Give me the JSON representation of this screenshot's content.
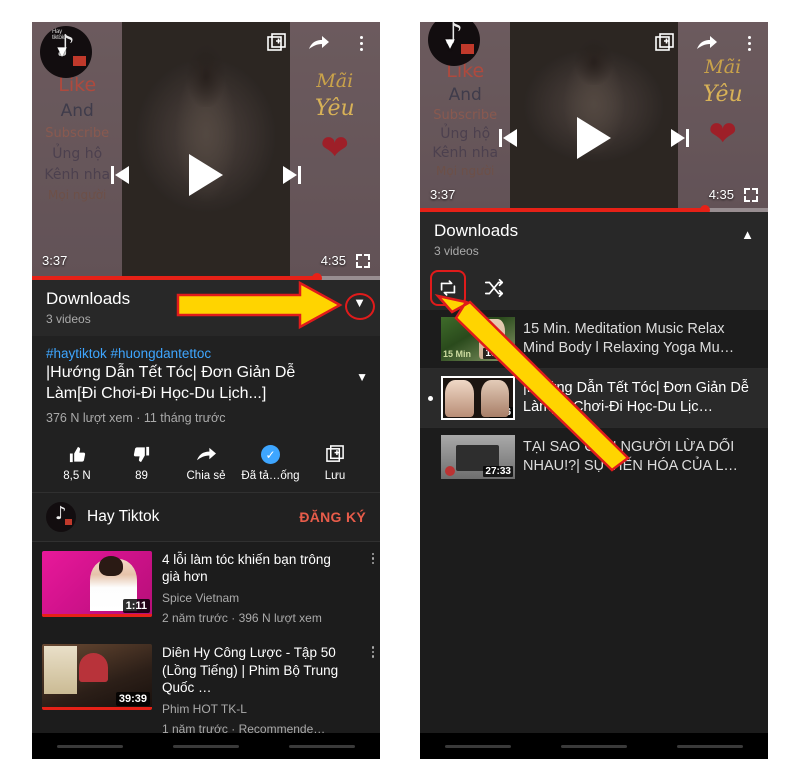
{
  "left_panel": {
    "player": {
      "avatar_icon": "tiktok-channel-avatar",
      "collapse_icon": "chevron-down-icon",
      "top_icons": [
        "add-to-queue-icon",
        "share-icon",
        "more-vertical-icon"
      ],
      "overlay_left_text": [
        "Like",
        "And",
        "Subscribe",
        "Ủng hộ",
        "Kênh nha",
        "Mọi người"
      ],
      "overlay_right_text": [
        "Mãi",
        "Yêu"
      ],
      "heart_icon": "heart-icon",
      "prev_icon": "skip-previous-icon",
      "play_icon": "play-icon",
      "next_icon": "skip-next-icon",
      "current_time": "3:37",
      "duration": "4:35",
      "fullscreen_icon": "fullscreen-icon",
      "progress_percent": 82
    },
    "downloads": {
      "title": "Downloads",
      "subtitle": "3 videos",
      "toggle_icon": "chevron-down-icon"
    },
    "description": {
      "tags": "#haytiktok #huongdantettoc",
      "title": "|Hướng Dẫn Tết Tóc| Đơn Giản Dễ Làm[Đi Chơi-Đi Học-Du Lịch...]",
      "meta": "376 N lượt xem · 11 tháng trước",
      "expand_icon": "chevron-down-icon"
    },
    "actions": [
      {
        "label": "8,5 N",
        "icon": "thumbs-up-icon"
      },
      {
        "label": "89",
        "icon": "thumbs-down-icon"
      },
      {
        "label": "Chia sẻ",
        "icon": "share-icon"
      },
      {
        "label": "Đã tả…ống",
        "icon": "downloaded-check-icon"
      },
      {
        "label": "Lưu",
        "icon": "save-icon"
      }
    ],
    "channel": {
      "name": "Hay Tiktok",
      "subscribe_label": "ĐĂNG KÝ",
      "avatar_icon": "tiktok-avatar-icon"
    },
    "related": [
      {
        "title": "4 lỗi làm tóc khiến bạn trông già hơn",
        "channel": "Spice Vietnam",
        "meta": "2 năm trước · 396 N lượt xem",
        "duration": "1:11",
        "menu_icon": "more-vertical-icon"
      },
      {
        "title": "Diên Hy Công Lược - Tập 50 (Lồng Tiếng) | Phim Bộ Trung Quốc …",
        "channel": "Phim HOT TK-L",
        "meta": "1 năm trước · Recommende…",
        "duration": "39:39",
        "menu_icon": "more-vertical-icon"
      }
    ]
  },
  "right_panel": {
    "player": {
      "avatar_icon": "tiktok-channel-avatar",
      "collapse_icon": "chevron-down-icon",
      "top_icons": [
        "add-to-queue-icon",
        "share-icon",
        "more-vertical-icon"
      ],
      "overlay_left_text": [
        "Like",
        "And",
        "Subscribe",
        "Ủng hộ",
        "Kênh nha",
        "Mọi người"
      ],
      "overlay_right_text": [
        "Mãi",
        "Yêu"
      ],
      "heart_icon": "heart-icon",
      "prev_icon": "skip-previous-icon",
      "play_icon": "play-icon",
      "next_icon": "skip-next-icon",
      "current_time": "3:37",
      "duration": "4:35",
      "fullscreen_icon": "fullscreen-icon",
      "progress_percent": 82
    },
    "downloads": {
      "title": "Downloads",
      "subtitle": "3 videos",
      "toggle_icon": "chevron-up-icon"
    },
    "playlist_controls": [
      {
        "icon": "repeat-icon",
        "highlighted": true
      },
      {
        "icon": "shuffle-icon",
        "highlighted": false
      }
    ],
    "playlist": [
      {
        "title": "15 Min. Meditation Music Relax Mind Body l Relaxing Yoga Mu…",
        "duration": "15:15",
        "active": false
      },
      {
        "title": "|Hướng Dẫn Tết Tóc| Đơn Giản Dễ Làm[Đi Chơi-Đi Học-Du Lịc…",
        "duration": "4:36",
        "active": true
      },
      {
        "title": "TẠI SAO CON NGƯỜI LỪA DỐI NHAU!?| SỰ TIẾN HÓA CỦA L…",
        "duration": "27:33",
        "active": false
      }
    ]
  },
  "annotations": {
    "arrow_color": "#FFD400",
    "arrow_outline": "#E01B1B",
    "left_arrow_target": "downloads-collapse-chevron",
    "right_arrow_target": "repeat-button"
  },
  "navbar": {
    "items": [
      "nav-back-line",
      "nav-home-line",
      "nav-recents-line"
    ]
  }
}
